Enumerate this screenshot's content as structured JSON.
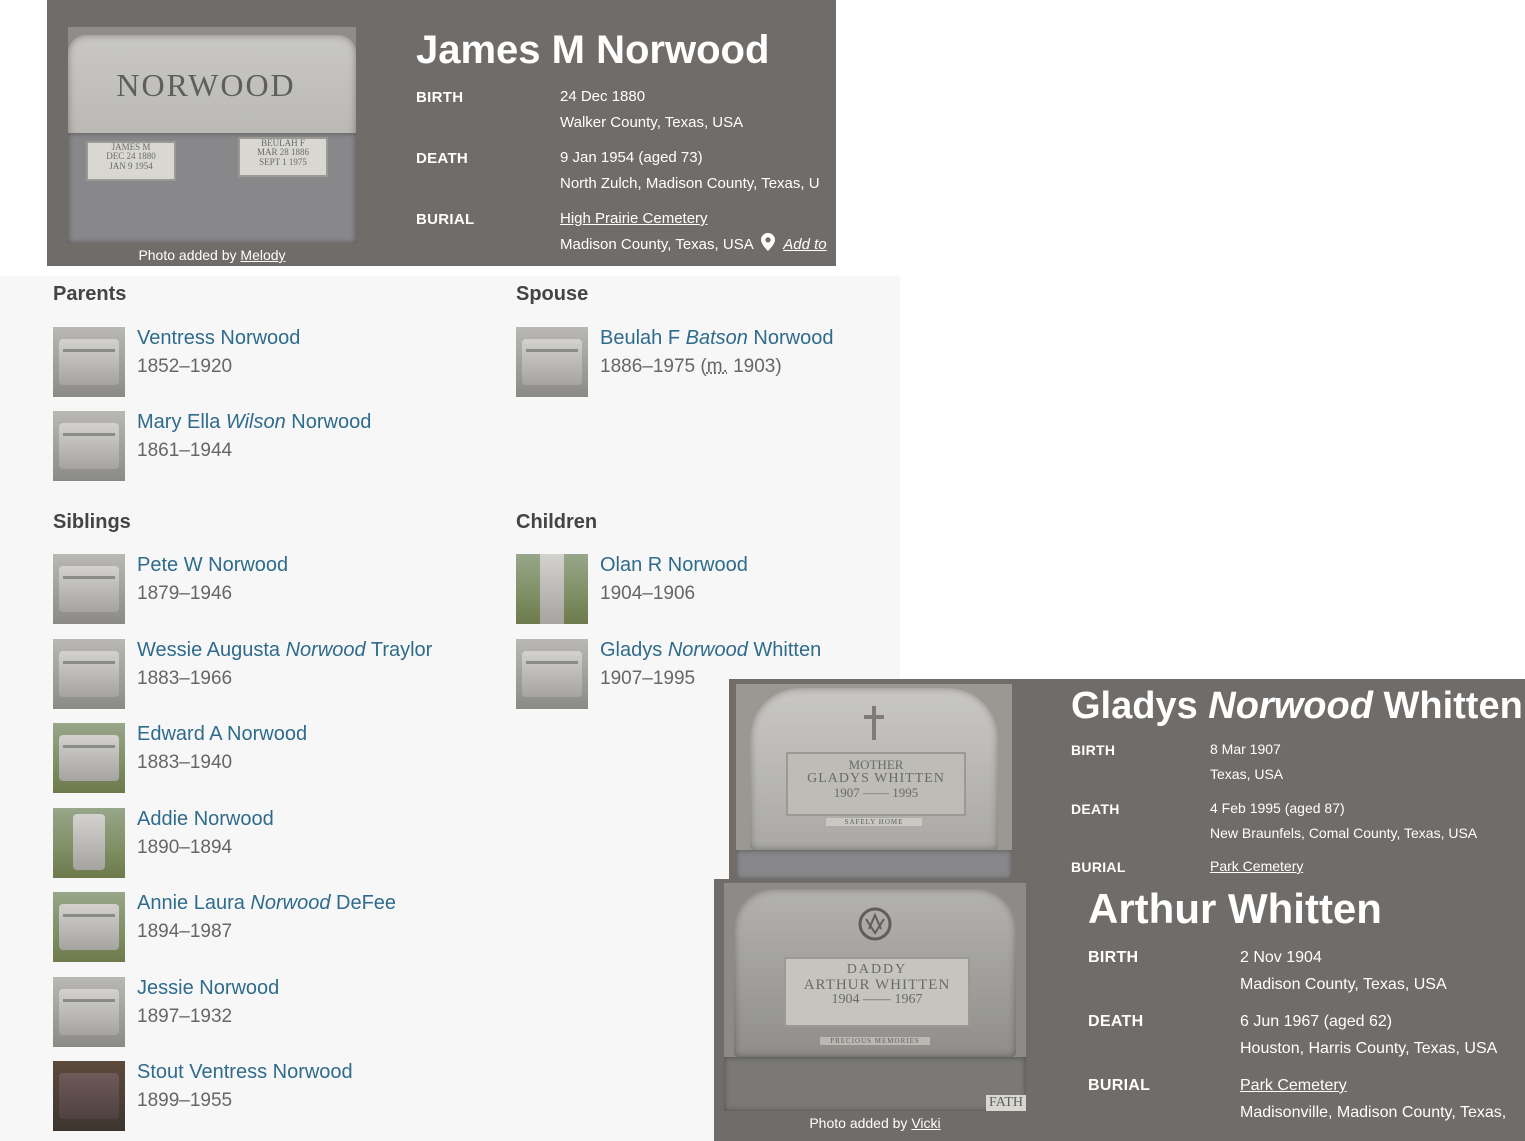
{
  "main": {
    "name": "James M Norwood",
    "birth_label": "BIRTH",
    "birth_date": "24 Dec 1880",
    "birth_place": "Walker County, Texas, USA",
    "death_label": "DEATH",
    "death_date": "9 Jan 1954 (aged 73)",
    "death_place": "North Zulch, Madison County, Texas, U",
    "burial_label": "BURIAL",
    "burial_cemetery": "High Prairie Cemetery",
    "burial_place": "Madison County, Texas, USA",
    "add_to": "Add to",
    "photo_caption_prefix": "Photo added by",
    "photo_caption_user": "Melody",
    "stone_text": "NORWOOD",
    "plaque_left": "JAMES M\nDEC 24 1880\nJAN 9 1954",
    "plaque_right": "BEULAH F\nMAR 28 1886\nSEPT 1 1975"
  },
  "family": {
    "parents_title": "Parents",
    "spouse_title": "Spouse",
    "siblings_title": "Siblings",
    "children_title": "Children",
    "parents": [
      {
        "first": "Ventress Norwood",
        "maiden": "",
        "last": "",
        "dates": "1852–1920"
      },
      {
        "first": "Mary Ella ",
        "maiden": "Wilson",
        "last": " Norwood",
        "dates": "1861–1944"
      }
    ],
    "spouse": {
      "first": "Beulah F ",
      "maiden": "Batson",
      "last": " Norwood",
      "dates_prefix": "1886–1975 (",
      "married_abbr": "m.",
      "dates_suffix": " 1903)"
    },
    "siblings": [
      {
        "first": "Pete W Norwood",
        "maiden": "",
        "last": "",
        "dates": "1879–1946"
      },
      {
        "first": "Wessie Augusta ",
        "maiden": "Norwood",
        "last": " Traylor",
        "dates": "1883–1966"
      },
      {
        "first": "Edward A Norwood",
        "maiden": "",
        "last": "",
        "dates": "1883–1940"
      },
      {
        "first": "Addie Norwood",
        "maiden": "",
        "last": "",
        "dates": "1890–1894"
      },
      {
        "first": "Annie Laura ",
        "maiden": "Norwood",
        "last": " DeFee",
        "dates": "1894–1987"
      },
      {
        "first": "Jessie Norwood",
        "maiden": "",
        "last": "",
        "dates": "1897–1932"
      },
      {
        "first": "Stout Ventress Norwood",
        "maiden": "",
        "last": "",
        "dates": "1899–1955"
      }
    ],
    "children": [
      {
        "first": "Olan R Norwood",
        "maiden": "",
        "last": "",
        "dates": "1904–1906"
      },
      {
        "first": "Gladys ",
        "maiden": "Norwood",
        "last": " Whitten",
        "dates": "1907–1995"
      }
    ]
  },
  "gladys": {
    "first": "Gladys ",
    "maiden": "Norwood",
    "last": " Whitten",
    "birth_label": "BIRTH",
    "birth_date": "8 Mar 1907",
    "birth_place": "Texas, USA",
    "death_label": "DEATH",
    "death_date": "4 Feb 1995 (aged 87)",
    "death_place": "New Braunfels, Comal County, Texas, USA",
    "burial_label": "BURIAL",
    "burial_cemetery": "Park Cemetery",
    "stone_line1": "MOTHER",
    "stone_line2": "GLADYS WHITTEN",
    "stone_line3": "1907 —— 1995",
    "stone_line4": "SAFELY HOME"
  },
  "arthur": {
    "name": "Arthur Whitten",
    "birth_label": "BIRTH",
    "birth_date": "2 Nov 1904",
    "birth_place": "Madison County, Texas, USA",
    "death_label": "DEATH",
    "death_date": "6 Jun 1967 (aged 62)",
    "death_place": "Houston, Harris County, Texas, USA",
    "burial_label": "BURIAL",
    "burial_cemetery": "Park Cemetery",
    "burial_place": "Madisonville, Madison County, Texas,",
    "photo_caption_prefix": "Photo added by",
    "photo_caption_user": "Vicki",
    "stone_line1": "DADDY",
    "stone_line2": "ARTHUR WHITTEN",
    "stone_line3": "1904 —— 1967",
    "stone_line4": "PRECIOUS MEMORIES",
    "stone_corner": "FATH"
  }
}
